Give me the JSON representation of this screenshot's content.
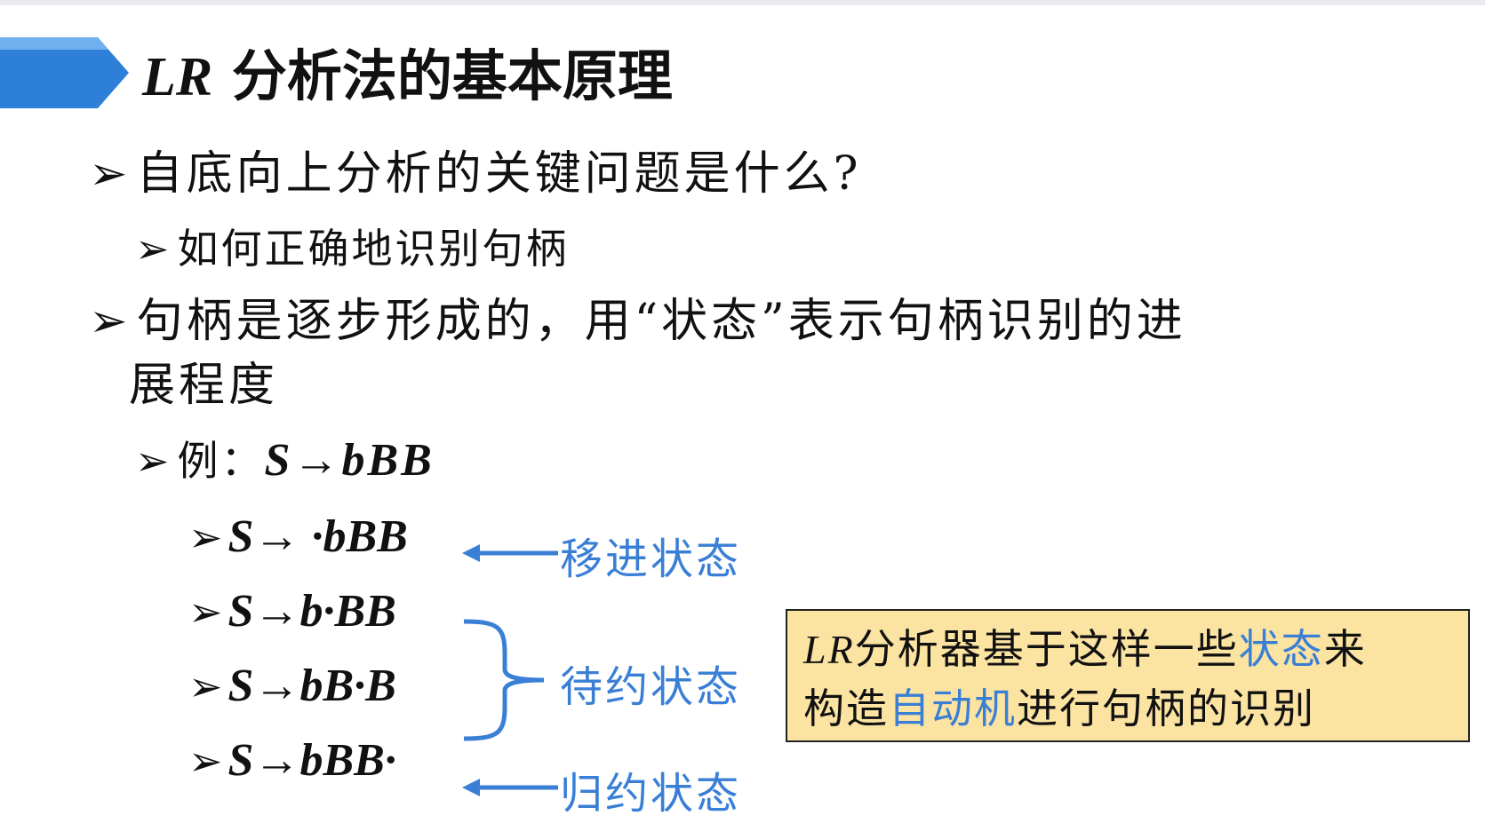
{
  "slide": {
    "title_prefix": "LR",
    "title_main": " 分析法的基本原理",
    "bullet_mark": "➢",
    "b1": "自底向上分析的关键问题是什么?",
    "b1_sub": "如何正确地识别句柄",
    "b2_line1": "句柄是逐步形成的，用“状态”表示句柄识别的进",
    "b2_line2": "展程度",
    "example_prefix": "例：",
    "example_rule": "S→bBB",
    "items": [
      {
        "text": "S→ ·bBB"
      },
      {
        "text": "S→b·BB"
      },
      {
        "text": "S→bB·B"
      },
      {
        "text": "S→bBB·"
      }
    ],
    "labels": {
      "shift": "移进状态",
      "pending": "待约状态",
      "reduce": "归约状态"
    },
    "note": {
      "p1_lr": "LR",
      "p1": "分析器基于这样一些",
      "p1_hl": "状态",
      "p1_end": "来",
      "p2": "构造",
      "p2_hl": "自动机",
      "p2_end": "进行句柄的识别"
    },
    "colors": {
      "accent_blue": "#3a7fd6",
      "banner_blue": "#2e7fd8",
      "note_bg": "#fbe3a2"
    }
  }
}
